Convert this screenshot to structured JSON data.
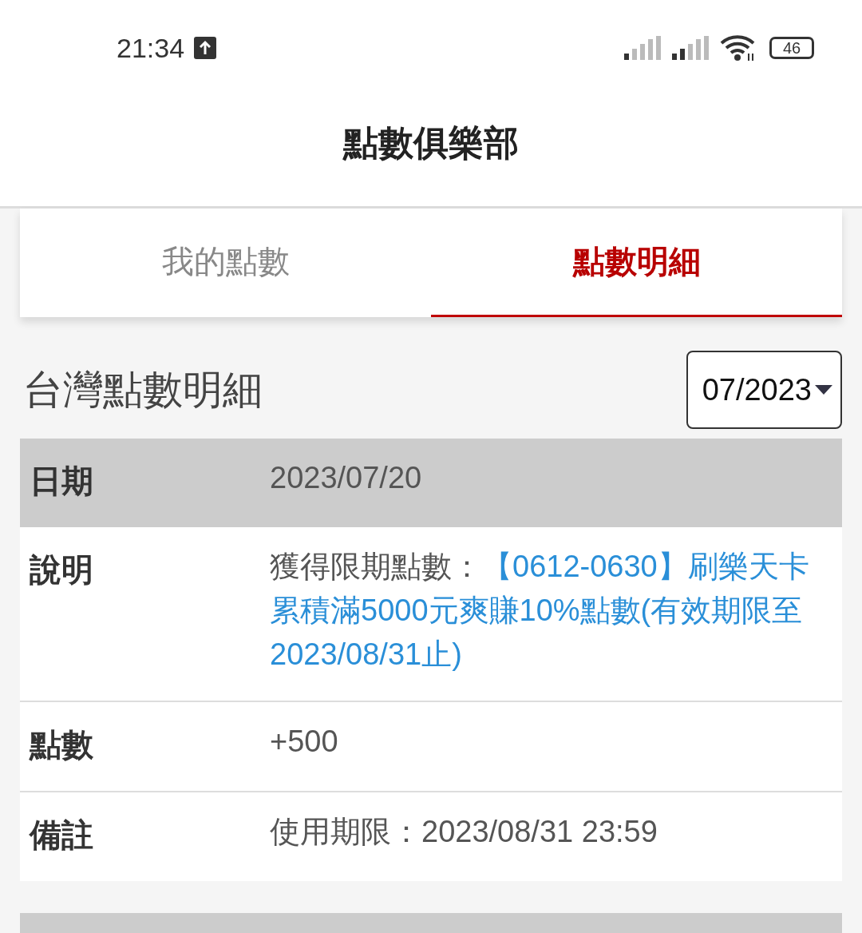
{
  "status_bar": {
    "time": "21:34",
    "battery": "46"
  },
  "header": {
    "title": "點數俱樂部"
  },
  "tabs": [
    {
      "label": "我的點數",
      "selected": false
    },
    {
      "label": "點數明細",
      "selected": true
    }
  ],
  "section": {
    "title": "台灣點數明細",
    "month_select": {
      "value": "07/2023"
    }
  },
  "records": [
    {
      "rows": [
        {
          "kind": "header",
          "label": "日期",
          "value": "2023/07/20"
        },
        {
          "kind": "description",
          "label": "說明",
          "value": "獲得限期點數：",
          "link": "【0612-0630】刷樂天卡累積滿5000元爽賺10%點數(有效期限至2023/08/31止)"
        },
        {
          "kind": "plain",
          "label": "點數",
          "value": "+500"
        },
        {
          "kind": "plain",
          "label": "備註",
          "value": "使用期限：2023/08/31 23:59"
        }
      ]
    },
    {
      "kind": "stub"
    }
  ]
}
